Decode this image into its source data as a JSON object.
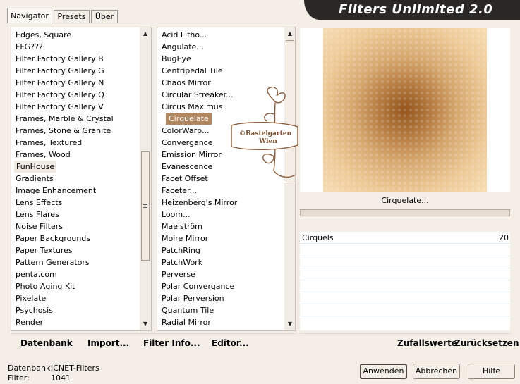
{
  "banner": {
    "title": "Filters Unlimited 2.0"
  },
  "tabs": [
    {
      "label": "Navigator",
      "active": true
    },
    {
      "label": "Presets",
      "active": false
    },
    {
      "label": "Über",
      "active": false
    }
  ],
  "categories": {
    "items": [
      "Edges, Square",
      "FFG???",
      "Filter Factory Gallery B",
      "Filter Factory Gallery G",
      "Filter Factory Gallery N",
      "Filter Factory Gallery Q",
      "Filter Factory Gallery V",
      "Frames, Marble & Crystal",
      "Frames, Stone & Granite",
      "Frames, Textured",
      "Frames, Wood",
      "FunHouse",
      "Gradients",
      "Image Enhancement",
      "Lens Effects",
      "Lens Flares",
      "Noise Filters",
      "Paper Backgrounds",
      "Paper Textures",
      "Pattern Generators",
      "penta.com",
      "Photo Aging Kit",
      "Pixelate",
      "Psychosis",
      "Render"
    ],
    "selected": "FunHouse"
  },
  "filters": {
    "items": [
      "Acid Litho...",
      "Angulate...",
      "BugEye",
      "Centripedal Tile",
      "Chaos Mirror",
      "Circular Streaker...",
      "Circus Maximus",
      "Cirquelate",
      "ColorWarp...",
      "Convergance",
      "Emission Mirror",
      "Evanescence",
      "Facet Offset",
      "Faceter...",
      "Heizenberg's Mirror",
      "Loom...",
      "Maelström",
      "Moire Mirror",
      "PatchRing",
      "PatchWork",
      "Perverse",
      "Polar Convergance",
      "Polar Perversion",
      "Quantum Tile",
      "Radial Mirror"
    ],
    "selected": "Cirquelate"
  },
  "left_toolbar": {
    "datenbank": "Datenbank",
    "import": "Import...",
    "filter_info": "Filter Info...",
    "editor": "Editor..."
  },
  "right_toolbar": {
    "zufallswerte": "Zufallswerte",
    "zuruecksetzen": "Zurücksetzen"
  },
  "preview": {
    "filter_name": "Cirquelate...",
    "params": [
      {
        "name": "Cirquels",
        "value": "20"
      }
    ]
  },
  "watermark": {
    "line1": "©Bastelgarten",
    "line2": "Wien"
  },
  "footer": {
    "db_label": "Datenbank:",
    "db_value": "ICNET-Filters",
    "filter_label": "Filter:",
    "filter_value": "1041",
    "apply": "Anwenden",
    "cancel": "Abbrechen",
    "help": "Hilfe"
  },
  "colors": {
    "selection": "#b2865e",
    "banner": "#2a2826",
    "preview_center": "#94561e",
    "preview_edge": "#f7ddb4"
  }
}
